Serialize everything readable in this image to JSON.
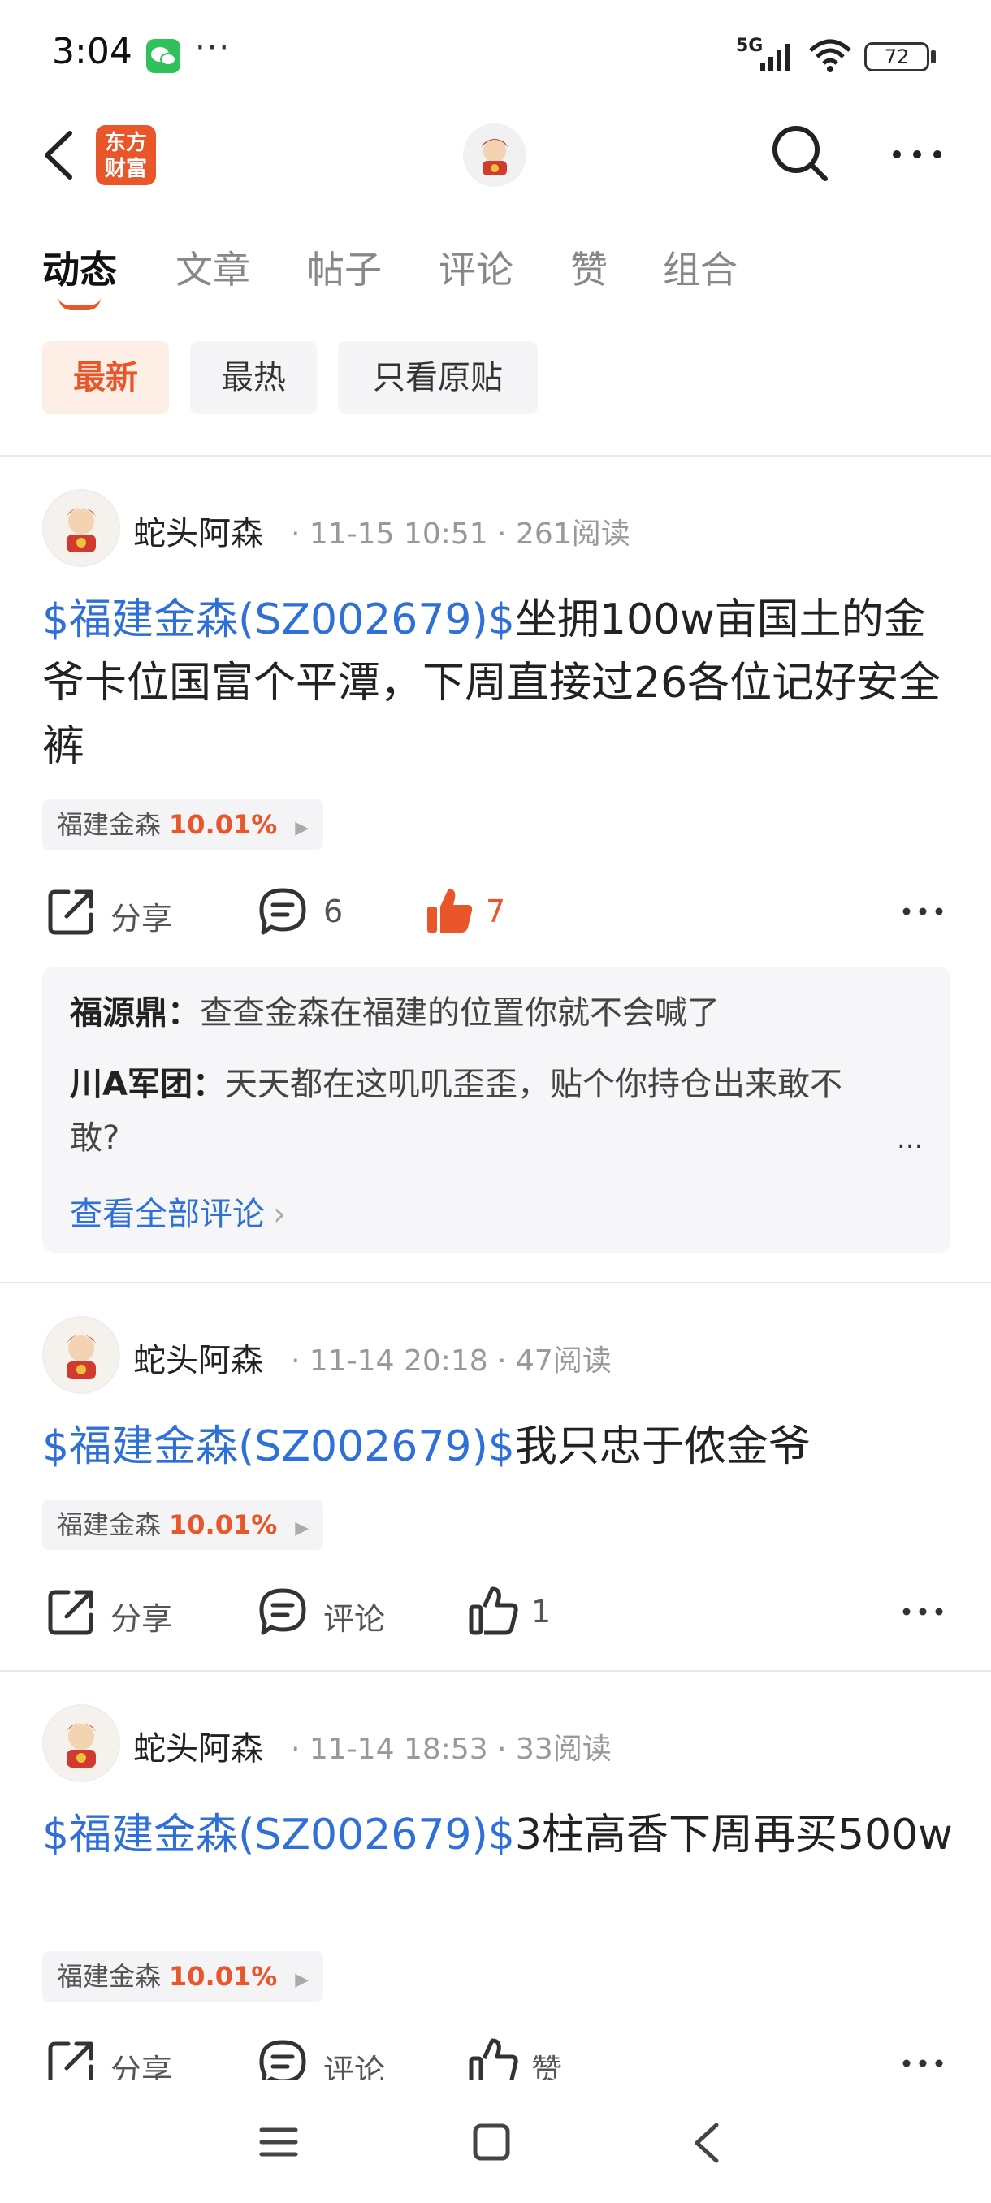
{
  "status_bar": {
    "time": "3:04",
    "dots": "···",
    "network": "5G",
    "battery": "72"
  },
  "header": {
    "logo_text_line1": "东方",
    "logo_text_line2": "财富"
  },
  "tabs": [
    {
      "label": "动态",
      "active": true
    },
    {
      "label": "文章"
    },
    {
      "label": "帖子"
    },
    {
      "label": "评论"
    },
    {
      "label": "赞"
    },
    {
      "label": "组合"
    }
  ],
  "filters": [
    {
      "label": "最新",
      "active": true
    },
    {
      "label": "最热"
    },
    {
      "label": "只看原贴"
    }
  ],
  "posts": [
    {
      "author": "蛇头阿森",
      "meta": "· 11-15 10:51 · 261阅读",
      "stock_link": "$福建金森(SZ002679)$",
      "text": "坐拥100w亩国土的金爷卡位国富个平潭，下周直接过26各位记好安全裤",
      "tag_name": "福建金森",
      "tag_pct": "10.01%",
      "share_label": "分享",
      "comment_label": "6",
      "like_label": "7",
      "comments": [
        {
          "user": "福源鼎：",
          "text": "查查金森在福建的位置你就不会喊了"
        },
        {
          "user": "川A军团：",
          "text": "天天都在这叽叽歪歪，贴个你持仓出来敢不敢?"
        }
      ],
      "comments_more": "...",
      "view_all": "查看全部评论"
    },
    {
      "author": "蛇头阿森",
      "meta": "· 11-14 20:18 · 47阅读",
      "stock_link": "$福建金森(SZ002679)$",
      "text": "我只忠于侬金爷",
      "tag_name": "福建金森",
      "tag_pct": "10.01%",
      "share_label": "分享",
      "comment_label": "评论",
      "like_label": "1"
    },
    {
      "author": "蛇头阿森",
      "meta": "· 11-14 18:53 · 33阅读",
      "stock_link": "$福建金森(SZ002679)$",
      "text": "3柱高香下周再买500w",
      "tag_name": "福建金森",
      "tag_pct": "10.01%",
      "share_label": "分享",
      "comment_label": "评论",
      "like_label": "赞"
    }
  ],
  "icons": {
    "back": "chevron-left-icon",
    "search": "search-icon",
    "more": "more-horizontal-icon",
    "share": "share-icon",
    "comment": "comment-icon",
    "like": "thumb-up-icon"
  },
  "colors": {
    "accent": "#e8562a",
    "link": "#2f6fd8",
    "wechat": "#2fc25b"
  }
}
